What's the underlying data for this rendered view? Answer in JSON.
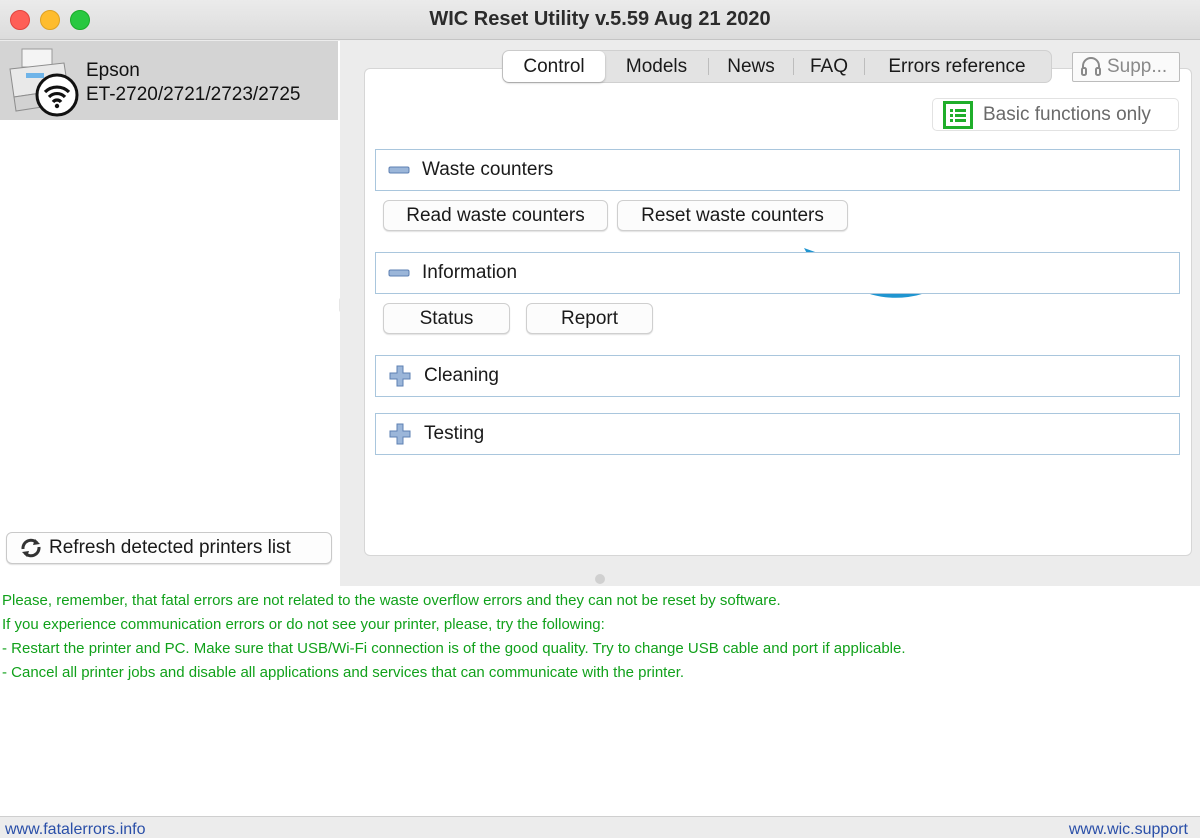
{
  "window": {
    "title": "WIC Reset Utility v.5.59 Aug 21 2020"
  },
  "printers": [
    {
      "brand": "Epson",
      "model": "ET-2720/2721/2723/2725"
    }
  ],
  "left_panel": {
    "refresh_label": "Refresh detected printers list"
  },
  "tabs": [
    {
      "label": "Control",
      "active": true
    },
    {
      "label": "Models",
      "active": false
    },
    {
      "label": "News",
      "active": false
    },
    {
      "label": "FAQ",
      "active": false
    },
    {
      "label": "Errors reference",
      "active": false
    }
  ],
  "support_label": "Supp...",
  "basic_functions_label": "Basic functions only",
  "sections": {
    "waste": {
      "title": "Waste counters",
      "expanded": true,
      "buttons": {
        "read": "Read waste counters",
        "reset": "Reset waste counters"
      }
    },
    "information": {
      "title": "Information",
      "expanded": true,
      "buttons": {
        "status": "Status",
        "report": "Report"
      }
    },
    "cleaning": {
      "title": "Cleaning",
      "expanded": false
    },
    "testing": {
      "title": "Testing",
      "expanded": false
    }
  },
  "log": [
    "Please, remember, that fatal errors are not related to the waste overflow errors and they can not be reset by software.",
    "If you experience communication errors or do not see your printer, please, try the following:",
    "- Restart the printer and PC. Make sure that USB/Wi-Fi connection is of the good quality. Try to change USB cable and port if applicable.",
    "- Cancel all printer jobs and disable all applications and services that can communicate with the printer."
  ],
  "status_bar": {
    "left_link": "www.fatalerrors.info",
    "right_link": "www.wic.support"
  },
  "colors": {
    "log_text": "#11a11b",
    "link": "#2a4fa8",
    "section_border": "#a9c6dd",
    "annotation_arrow": "#1f95d0",
    "basic_icon": "#1fae2a"
  }
}
